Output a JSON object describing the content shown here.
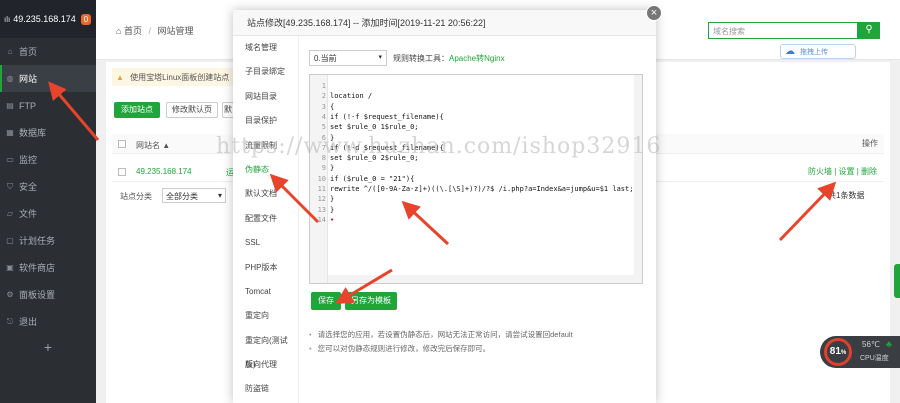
{
  "sidebar": {
    "ip": "49.235.168.174",
    "badge": "0",
    "items": [
      {
        "label": "首页",
        "icon": "home-icon",
        "glyph": "⌂"
      },
      {
        "label": "网站",
        "icon": "globe-icon",
        "glyph": "◍"
      },
      {
        "label": "FTP",
        "icon": "ftp-icon",
        "glyph": "▤"
      },
      {
        "label": "数据库",
        "icon": "database-icon",
        "glyph": "▦"
      },
      {
        "label": "监控",
        "icon": "monitor-icon",
        "glyph": "▭"
      },
      {
        "label": "安全",
        "icon": "shield-icon",
        "glyph": "⛉"
      },
      {
        "label": "文件",
        "icon": "folder-icon",
        "glyph": "▱"
      },
      {
        "label": "计划任务",
        "icon": "calendar-icon",
        "glyph": "▢"
      },
      {
        "label": "软件商店",
        "icon": "store-icon",
        "glyph": "▣"
      },
      {
        "label": "面板设置",
        "icon": "settings-icon",
        "glyph": "⚙"
      },
      {
        "label": "退出",
        "icon": "logout-icon",
        "glyph": "⎋"
      }
    ],
    "add": "+"
  },
  "topbar": {
    "home": "首页",
    "sep": "/",
    "section": "网站管理",
    "search_placeholder": "域名搜索",
    "search_icon": "🔍",
    "upload_label": "拖拽上传"
  },
  "page": {
    "warning": "使用宝塔Linux面板创建站点",
    "add_site": "添加站点",
    "edit_default": "修改默认页",
    "btn3": "默",
    "col_name": "网站名 ▲",
    "col_op": "操作",
    "row_site": "49.235.168.174",
    "row_status": "运",
    "site_category": "站点分类",
    "category_all": "全部分类",
    "category_caret": "▾",
    "actions": "防火墙 | 设置 | 删除",
    "paging": "共1条数据"
  },
  "modal": {
    "title": "站点修改[49.235.168.174] -- 添加时间[2019-11-21 20:56:22]",
    "close": "×",
    "tabs": [
      "域名管理",
      "子目录绑定",
      "网站目录",
      "目录保护",
      "流量限制",
      "伪静态",
      "默认文档",
      "配置文件",
      "SSL",
      "PHP版本",
      "Tomcat",
      "重定向",
      "重定向(测试版)",
      "反向代理",
      "防盗链"
    ],
    "template_value": "0.当前",
    "template_caret": "▾",
    "tool_prefix": "规则转换工具：",
    "tool_link": "Apache转Nginx",
    "code_lines": [
      "",
      "location /",
      "{",
      "if (!-f $request_filename){",
      "set $rule_0 1$rule_0;",
      "}",
      "if (!-d $request_filename){",
      "set $rule_0 2$rule_0;",
      "}",
      "if ($rule_0 = \"21\"){",
      "rewrite ^/([0-9A-Za-z]+)((\\.[\\S]+)?)/?$ /i.php?a=Index&a=jump&u=$1 last;",
      "}",
      "}",
      ""
    ],
    "save": "保存",
    "save_template": "另存为模板",
    "tips": [
      "请选择您的应用，若设置伪静态后，网站无法正常访问，请尝试设置回default",
      "您可以对伪静态规则进行修改，修改完后保存即可。"
    ]
  },
  "cpu": {
    "percent": "81",
    "unit": "%",
    "temp": "56℃",
    "label": "CPU温度",
    "leaf": "🌿"
  },
  "watermark": "https://www.huzhan.com/ishop32916",
  "colors": {
    "accent": "#20a53a",
    "sidebar": "#2b2e33",
    "arrow": "#e8442c"
  }
}
